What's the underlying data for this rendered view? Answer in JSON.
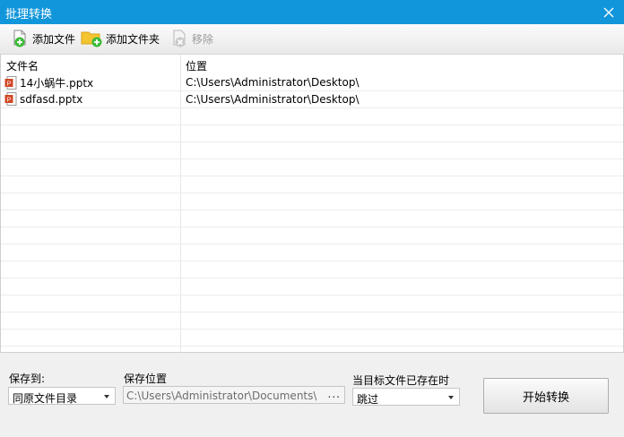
{
  "window": {
    "title": "批理转换"
  },
  "toolbar": {
    "add_file": "添加文件",
    "add_folder": "添加文件夹",
    "remove": "移除"
  },
  "list": {
    "columns": [
      "文件名",
      "位置"
    ],
    "rows": [
      {
        "name": "14小蜗牛.pptx",
        "location": "C:\\Users\\Administrator\\Desktop\\"
      },
      {
        "name": "sdfasd.pptx",
        "location": "C:\\Users\\Administrator\\Desktop\\"
      }
    ]
  },
  "bottom": {
    "save_to_label": "保存到:",
    "save_to_value": "同原文件目录",
    "save_location_label": "保存位置",
    "save_location_value": "C:\\Users\\Administrator\\Documents\\",
    "browse_label": "...",
    "exists_label": "当目标文件已存在时",
    "exists_value": "跳过",
    "start_button": "开始转换"
  },
  "colors": {
    "titlebar": "#1296db",
    "add_green": "#3dbb3a",
    "folder_yellow": "#f5c431",
    "ppt_red": "#d24726"
  },
  "icons": [
    "close-icon",
    "add-file-icon",
    "add-folder-icon",
    "remove-icon",
    "pptx-file-icon"
  ]
}
